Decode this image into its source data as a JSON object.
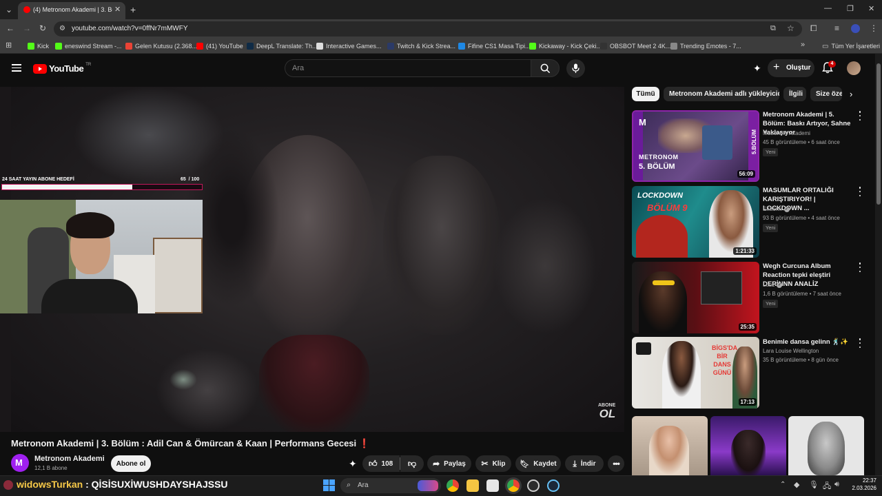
{
  "browser": {
    "tab_title": "(4) Metronom Akademi | 3. Bölü",
    "url": "youtube.com/watch?v=0ffNr7mMWFY",
    "bookmarks": [
      {
        "label": "Kick",
        "color": "#53fc18"
      },
      {
        "label": "eneswind Stream -...",
        "color": "#53fc18"
      },
      {
        "label": "Gelen Kutusu (2.368...",
        "color": "#ea4335"
      },
      {
        "label": "(41) YouTube",
        "color": "#ff0000"
      },
      {
        "label": "DeepL Translate: Th...",
        "color": "#0f2b46"
      },
      {
        "label": "Interactive Games...",
        "color": "#dddddd"
      },
      {
        "label": "Twitch & Kick Strea...",
        "color": "#2b3a67"
      },
      {
        "label": "Fifine CS1 Masa Tipi...",
        "color": "#1e88e5"
      },
      {
        "label": "Kickaway - Kick Çeki...",
        "color": "#53fc18"
      },
      {
        "label": "OBSBOT Meet 2 4K...",
        "color": "#333333"
      },
      {
        "label": "Trending Emotes - 7...",
        "color": "#888888"
      }
    ],
    "all_bookmarks_label": "Tüm Yer İşaretleri"
  },
  "youtube": {
    "logo_text": "YouTube",
    "country_code": "TR",
    "search_placeholder": "Ara",
    "create_label": "Oluştur",
    "notifications_count": "4"
  },
  "overlay": {
    "goal_label": "24 SAAT YAYIN ABONE HEDEFİ",
    "goal_count": "65  / 100",
    "goal_fraction": 0.65,
    "watermark_top": "ABONE",
    "watermark_bottom": "OL"
  },
  "video": {
    "title": "Metronom Akademi | 3. Bölüm : Adil Can & Ömürcan & Kaan | Performans Gecesi",
    "title_emoji": "❗",
    "channel_name": "Metronom Akademi",
    "channel_subs": "12,1 B abone",
    "subscribe_label": "Abone ol",
    "like_count": "108",
    "share_label": "Paylaş",
    "clip_label": "Klip",
    "save_label": "Kaydet",
    "download_label": "İndir"
  },
  "chips": [
    "Tümü",
    "Metronom Akademi adlı yükleyiciden",
    "İlgili",
    "Size öze"
  ],
  "recommendations": [
    {
      "title": "Metronom Akademi | 5. Bölüm: Baskı Artıyor, Sahne Yaklaşıyor",
      "channel": "Metronom Akademi",
      "stats": "45 B görüntüleme • 6 saat önce",
      "badge": "Yeni",
      "duration": "56:09",
      "thumb_text": "5. BÖLÜM",
      "thumb_brand": "METRONOM",
      "thumb_side": "5.BÖLÜM"
    },
    {
      "title": "MASUMLAR ORTALIĞI KARIŞTIRIYOR! | LOCKDOWN ...",
      "channel": "Elraenn",
      "stats": "93 B görüntüleme • 4 saat önce",
      "badge": "Yeni",
      "duration": "1:21:33",
      "thumb_text": "LOCKDOWN",
      "thumb_sub": "BÖLÜM 9"
    },
    {
      "title": "Wegh Curcuna Album Reaction tepki eleştiri DERİNNN ANALİZ",
      "channel": "Lubz",
      "stats": "1,6 B görüntüleme • 7 saat önce",
      "badge": "Yeni",
      "duration": "25:35"
    },
    {
      "title": "Benimle dansa gelinn 🕺✨",
      "channel": "Lara Louise Wellington",
      "stats": "35 B görüntüleme • 8 gün önce",
      "duration": "17:13",
      "thumb_text": "BİGS'DA BİR DANS GÜNÜ"
    }
  ],
  "chat": {
    "user": "widowsTurkan",
    "separator": ":",
    "message": "QİSİSUXİWUSHDAYSHAJSSU"
  },
  "taskbar": {
    "search_label": "Ara",
    "time": "22:37",
    "date": "2.03.2026"
  }
}
